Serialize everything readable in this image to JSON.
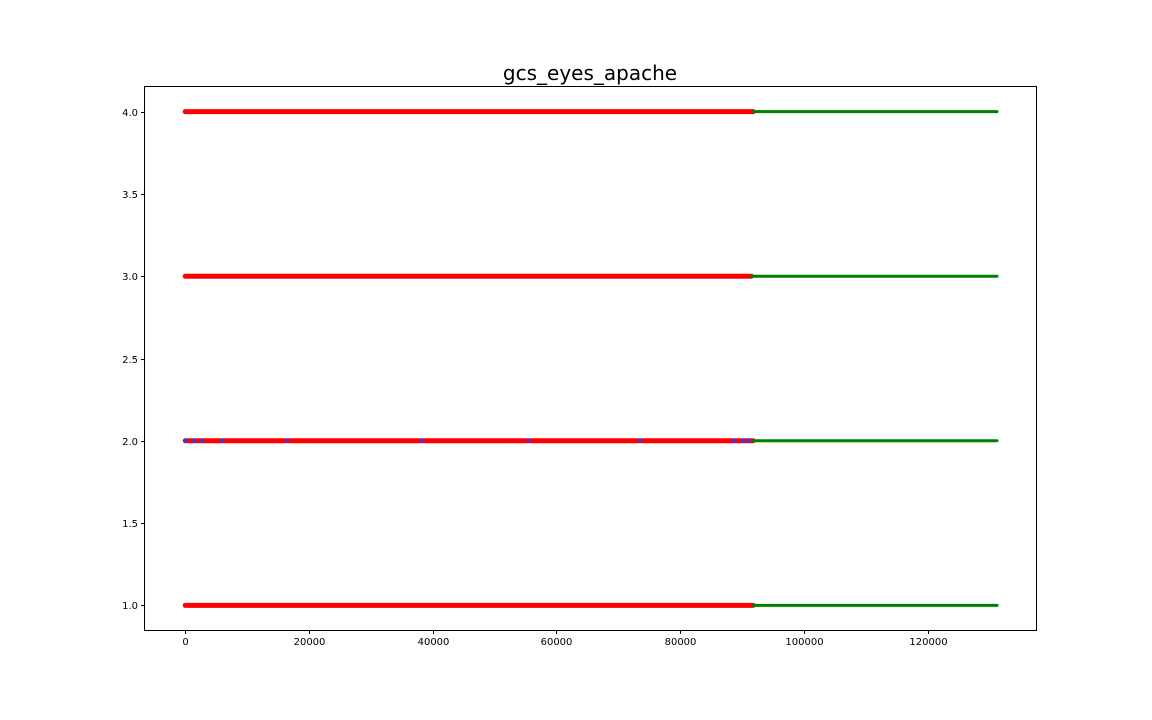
{
  "chart_data": {
    "type": "scatter",
    "title": "gcs_eyes_apache",
    "xlabel": "",
    "ylabel": "",
    "xlim": [
      -6500,
      137500
    ],
    "ylim": [
      0.85,
      4.15
    ],
    "x_ticks": [
      0,
      20000,
      40000,
      60000,
      80000,
      100000,
      120000
    ],
    "y_ticks": [
      1.0,
      1.5,
      2.0,
      2.5,
      3.0,
      3.5,
      4.0
    ],
    "y_tick_labels": [
      "1.0",
      "1.5",
      "2.0",
      "2.5",
      "3.0",
      "3.5",
      "4.0"
    ],
    "grid": false,
    "legend": "none",
    "series": [
      {
        "color": "#ff0000",
        "segments": [
          {
            "y": 4,
            "x_start": 0,
            "x_end": 91800
          },
          {
            "y": 3,
            "x_start": 0,
            "x_end": 91500
          },
          {
            "y": 2,
            "x_start": 0,
            "x_end": 91800
          },
          {
            "y": 1,
            "x_start": 0,
            "x_end": 91800
          }
        ]
      },
      {
        "color": "#008000",
        "segments": [
          {
            "y": 4,
            "x_start": 91800,
            "x_end": 131200
          },
          {
            "y": 3,
            "x_start": 91500,
            "x_end": 131200
          },
          {
            "y": 2,
            "x_start": 91800,
            "x_end": 131200
          },
          {
            "y": 1,
            "x_start": 91800,
            "x_end": 131200
          }
        ]
      },
      {
        "color": "#1f3fff",
        "points": [
          {
            "x": 100,
            "y": 2
          },
          {
            "x": 1400,
            "y": 2
          },
          {
            "x": 2600,
            "y": 2
          },
          {
            "x": 6000,
            "y": 2
          },
          {
            "x": 16500,
            "y": 2
          },
          {
            "x": 38200,
            "y": 2
          },
          {
            "x": 55500,
            "y": 2
          },
          {
            "x": 73500,
            "y": 2
          },
          {
            "x": 88700,
            "y": 2
          },
          {
            "x": 90200,
            "y": 2
          },
          {
            "x": 91000,
            "y": 2
          }
        ]
      }
    ]
  }
}
